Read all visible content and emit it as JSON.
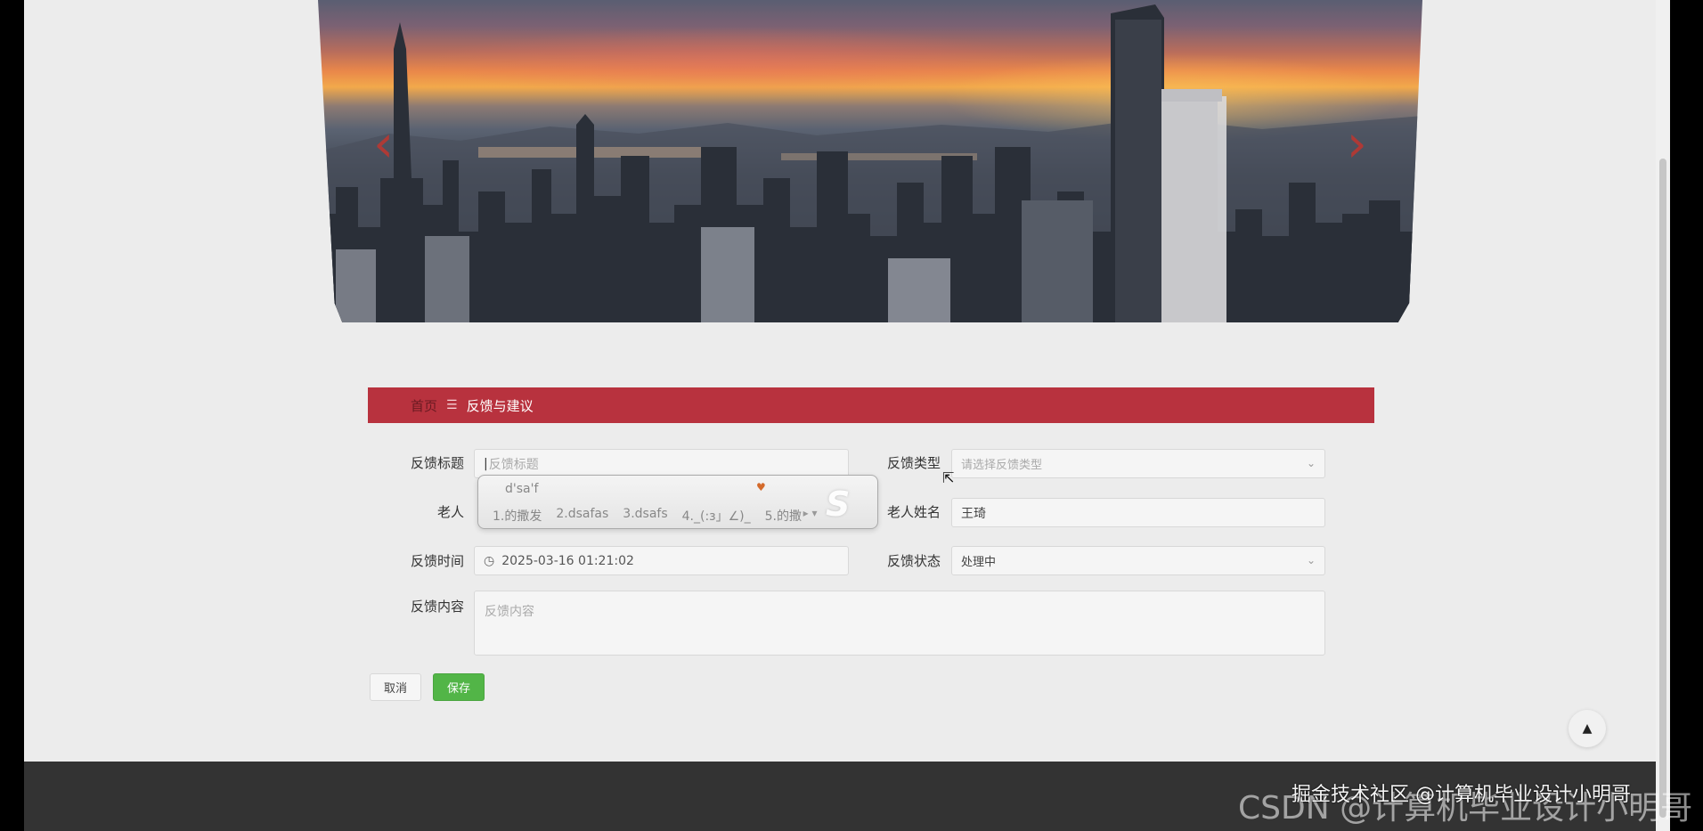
{
  "breadcrumb": {
    "home": "首页",
    "separator": "☰",
    "current": "反馈与建议"
  },
  "form": {
    "title_label": "反馈标题",
    "title_placeholder": "反馈标题",
    "type_label": "反馈类型",
    "type_placeholder": "请选择反馈类型",
    "elder_account_label": "老人",
    "elder_name_label": "老人姓名",
    "elder_name_value": "王琦",
    "time_label": "反馈时间",
    "time_value": "2025-03-16 01:21:02",
    "status_label": "反馈状态",
    "status_value": "处理中",
    "content_label": "反馈内容",
    "content_placeholder": "反馈内容"
  },
  "buttons": {
    "cancel": "取消",
    "save": "保存"
  },
  "ime": {
    "composition": "d'sa'f",
    "candidates": [
      "1.的撒发",
      "2.dsafas",
      "3.dsafs",
      "4._(:з」∠)_",
      "5.的撒"
    ],
    "logo": "S"
  },
  "watermark": {
    "line1": "掘金技术社区 @计算机毕业设计小明哥",
    "line2": "CSDN @计算机毕业设计小明哥"
  },
  "icons": [
    "chevron-left-icon",
    "chevron-right-icon",
    "clock-icon",
    "chevron-down-icon",
    "arrow-up-icon"
  ],
  "colors": {
    "crumb_bg": "#b8323e",
    "save_bg": "#52b547",
    "footer_bg": "#333333"
  }
}
